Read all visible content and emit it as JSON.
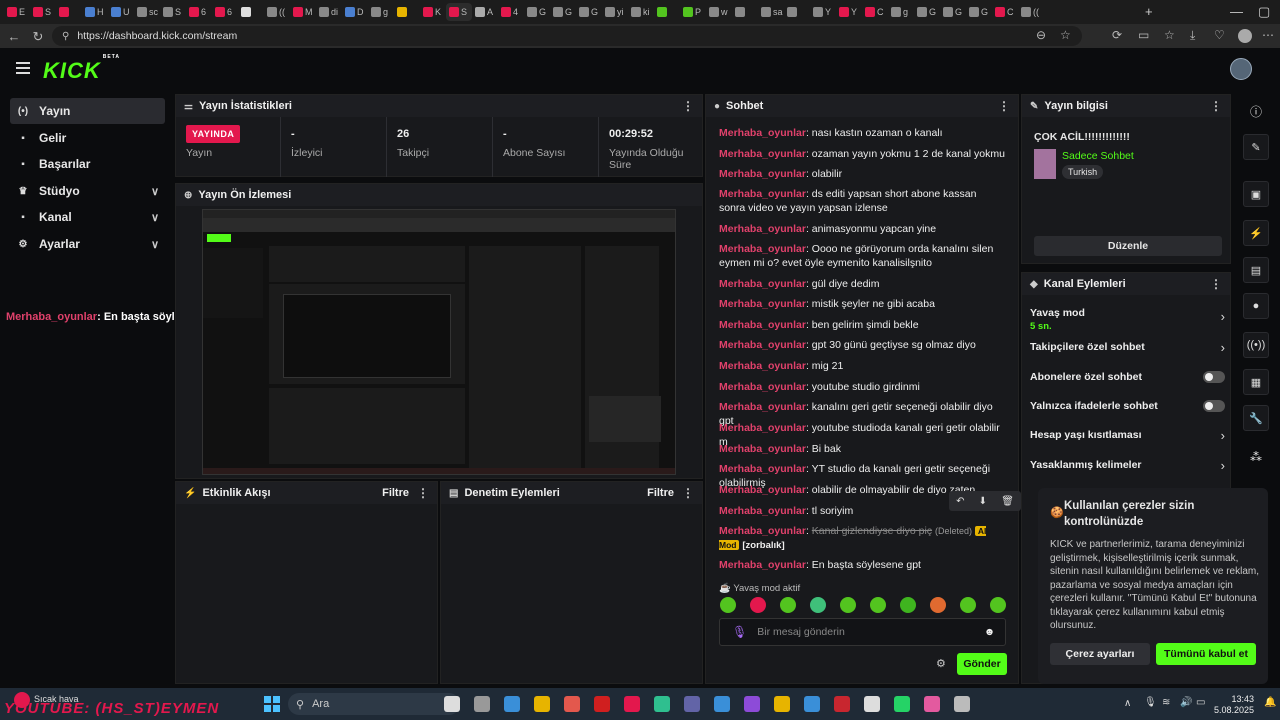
{
  "browser": {
    "url": "https://dashboard.kick.com/stream",
    "tabs": [
      {
        "label": "E",
        "color": "#e3184d"
      },
      {
        "label": "S",
        "color": "#e3184d"
      },
      {
        "label": "",
        "color": "#e3184d"
      },
      {
        "label": "H",
        "color": "#4a7fd0"
      },
      {
        "label": "U",
        "color": "#4a7fd0"
      },
      {
        "label": "sc",
        "color": "#888"
      },
      {
        "label": "S",
        "color": "#888"
      },
      {
        "label": "6",
        "color": "#e3184d"
      },
      {
        "label": "6",
        "color": "#e3184d"
      },
      {
        "label": "",
        "color": "#ddd"
      },
      {
        "label": "((",
        "color": "#888"
      },
      {
        "label": "M",
        "color": "#e3184d"
      },
      {
        "label": "di",
        "color": "#888"
      },
      {
        "label": "D",
        "color": "#4a7fd0"
      },
      {
        "label": "g",
        "color": "#888"
      },
      {
        "label": "",
        "color": "#e7b400"
      },
      {
        "label": "K",
        "color": "#e3184d"
      },
      {
        "label": "S",
        "color": "#e3184d"
      },
      {
        "label": "A",
        "color": "#aaa"
      },
      {
        "label": "4",
        "color": "#e3184d"
      },
      {
        "label": "G",
        "color": "#888"
      },
      {
        "label": "G",
        "color": "#888"
      },
      {
        "label": "G",
        "color": "#888"
      },
      {
        "label": "yi",
        "color": "#888"
      },
      {
        "label": "ki",
        "color": "#888"
      },
      {
        "label": "",
        "color": "#53c41f"
      },
      {
        "label": "P",
        "color": "#53c41f"
      },
      {
        "label": "w",
        "color": "#888"
      },
      {
        "label": "",
        "color": "#888"
      },
      {
        "label": "sa",
        "color": "#888"
      },
      {
        "label": "",
        "color": "#888"
      },
      {
        "label": "Y",
        "color": "#888"
      },
      {
        "label": "Y",
        "color": "#e3184d"
      },
      {
        "label": "C",
        "color": "#e3184d"
      },
      {
        "label": "g",
        "color": "#888"
      },
      {
        "label": "G",
        "color": "#888"
      },
      {
        "label": "G",
        "color": "#888"
      },
      {
        "label": "G",
        "color": "#888"
      },
      {
        "label": "C",
        "color": "#e3184d"
      },
      {
        "label": "((",
        "color": "#888"
      }
    ]
  },
  "header": {
    "logo": "KICK",
    "logo_badge": "BETA"
  },
  "nav": {
    "items": [
      {
        "label": "Yayın",
        "icon": "(•)",
        "selected": true,
        "chevron": false
      },
      {
        "label": "Gelir",
        "icon": "▪",
        "selected": false,
        "chevron": false
      },
      {
        "label": "Başarılar",
        "icon": "▪",
        "selected": false,
        "chevron": false
      },
      {
        "label": "Stüdyo",
        "icon": "♛",
        "selected": false,
        "chevron": true
      },
      {
        "label": "Kanal",
        "icon": "▪",
        "selected": false,
        "chevron": true
      },
      {
        "label": "Ayarlar",
        "icon": "⚙",
        "selected": false,
        "chevron": true
      }
    ]
  },
  "stats": {
    "title": "Yayın İstatistikleri",
    "live_badge": "YAYINDA",
    "items": [
      {
        "value": "",
        "label": "Yayın"
      },
      {
        "value": "-",
        "label": "İzleyici"
      },
      {
        "value": "26",
        "label": "Takipçi"
      },
      {
        "value": "-",
        "label": "Abone Sayısı"
      },
      {
        "value": "00:29:52",
        "label": "Yayında Olduğu Süre"
      }
    ]
  },
  "preview": {
    "title": "Yayın Ön İzlemesi"
  },
  "activity": {
    "title": "Etkinlik Akışı",
    "filter": "Filtre"
  },
  "moderation": {
    "title": "Denetim Eylemleri",
    "filter": "Filtre"
  },
  "overlay": {
    "user": "Merhaba_oyunlar",
    "text": "En başta söylesene gpt"
  },
  "chat": {
    "title": "Sohbet",
    "messages": [
      {
        "user": "Merhaba_oyunlar",
        "text": "nası kastın ozaman o kanalı"
      },
      {
        "user": "Merhaba_oyunlar",
        "text": "ozaman yayın yokmu 1 2 de kanal yokmu"
      },
      {
        "user": "Merhaba_oyunlar",
        "text": "olabilir"
      },
      {
        "user": "Merhaba_oyunlar",
        "text": "ds editi yapsan short abone kassan sonra video ve yayın yapsan izlense"
      },
      {
        "user": "Merhaba_oyunlar",
        "text": "animasyonmu yapcan yine"
      },
      {
        "user": "Merhaba_oyunlar",
        "text": "Oooo ne görüyorum orda kanalını silen eymen mi o? evet öyle eymenito kanalisilşnito"
      },
      {
        "user": "Merhaba_oyunlar",
        "text": "gül diye dedim"
      },
      {
        "user": "Merhaba_oyunlar",
        "text": "mistik şeyler ne gibi acaba"
      },
      {
        "user": "Merhaba_oyunlar",
        "text": "ben gelirim şimdi bekle"
      },
      {
        "user": "Merhaba_oyunlar",
        "text": "gpt 30 günü geçtiyse sg olmaz diyo"
      },
      {
        "user": "Merhaba_oyunlar",
        "text": "mig 21"
      },
      {
        "user": "Merhaba_oyunlar",
        "text": "youtube studio girdinmi"
      },
      {
        "user": "Merhaba_oyunlar",
        "text": "kanalını geri getir seçeneği olabilir diyo gpt"
      },
      {
        "user": "Merhaba_oyunlar",
        "text": "youtube studioda kanalı geri getir olabilir m"
      },
      {
        "user": "Merhaba_oyunlar",
        "text": "Bi bak"
      },
      {
        "user": "Merhaba_oyunlar",
        "text": "YT studio da kanalı geri getir seçeneği olabilirmiş"
      },
      {
        "user": "Merhaba_oyunlar",
        "text": "olabilir de olmayabilir de diyo zaten"
      },
      {
        "user": "Merhaba_oyunlar",
        "text": "tl soriyim"
      }
    ],
    "deleted": {
      "user": "Merhaba_oyunlar",
      "text": "Kanal gizlendiyse diyo piç",
      "tag": "(Deleted)",
      "mod": "AI Mod",
      "reason": "[zorbalık]"
    },
    "last": {
      "user": "Merhaba_oyunlar",
      "text": "En başta söylesene gpt"
    },
    "slowmode": "Yavaş mod aktif",
    "placeholder": "Bir mesaj gönderin",
    "send": "Gönder"
  },
  "info": {
    "title": "Yayın bilgisi",
    "stream_title": "ÇOK ACİL!!!!!!!!!!!!!",
    "category": "Sadece Sohbet",
    "tag": "Turkish",
    "edit": "Düzenle"
  },
  "channel_actions": {
    "title": "Kanal Eylemleri",
    "items": [
      {
        "label": "Yavaş mod",
        "sub": "5 sn.",
        "control": "chevron"
      },
      {
        "label": "Takipçilere özel sohbet",
        "sub": "",
        "control": "chevron"
      },
      {
        "label": "Abonelere özel sohbet",
        "sub": "",
        "control": "toggle"
      },
      {
        "label": "Yalnızca ifadelerle sohbet",
        "sub": "",
        "control": "toggle"
      },
      {
        "label": "Hesap yaşı kısıtlaması",
        "sub": "",
        "control": "chevron"
      },
      {
        "label": "Yasaklanmış kelimeler",
        "sub": "",
        "control": "chevron"
      }
    ]
  },
  "cookie": {
    "title": "Kullanılan çerezler sizin kontrolünüzde",
    "body": "KICK ve partnerlerimiz, tarama deneyiminizi geliştirmek, kişiselleştirilmiş içerik sunmak, sitenin nasıl kullanıldığını belirlemek ve reklam, pazarlama ve sosyal medya amaçları için çerezleri kullanır. \"Tümünü Kabul Et\" butonuna tıklayarak çerez kullanımını kabul etmiş olursunuz.",
    "settings": "Çerez ayarları",
    "accept": "Tümünü kabul et"
  },
  "taskbar": {
    "weather": "Sıcak hava",
    "search": "Ara",
    "time": "13:43",
    "date": "5.08.2025",
    "watermark": "YOUTUBE: (HS_ST)EYMEN"
  }
}
